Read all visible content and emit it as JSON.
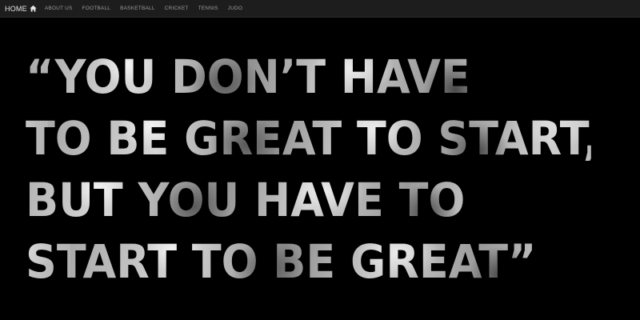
{
  "nav": {
    "home_label": "HOME",
    "home_icon": "home-icon",
    "items": [
      {
        "label": "ABOUT US"
      },
      {
        "label": "FOOTBALL"
      },
      {
        "label": "BASKETBALL"
      },
      {
        "label": "CRICKET"
      },
      {
        "label": "TENNIS"
      },
      {
        "label": "JUDO"
      }
    ]
  },
  "quote": {
    "lines": [
      "“YOU DON’T HAVE",
      "TO BE GREAT TO START,",
      "BUT YOU HAVE TO",
      "START TO BE GREAT”"
    ]
  },
  "colors": {
    "background": "#000000",
    "navbar": "#1d1d1d",
    "nav_text": "#9a9a9a",
    "home_text": "#e6e6e6"
  }
}
